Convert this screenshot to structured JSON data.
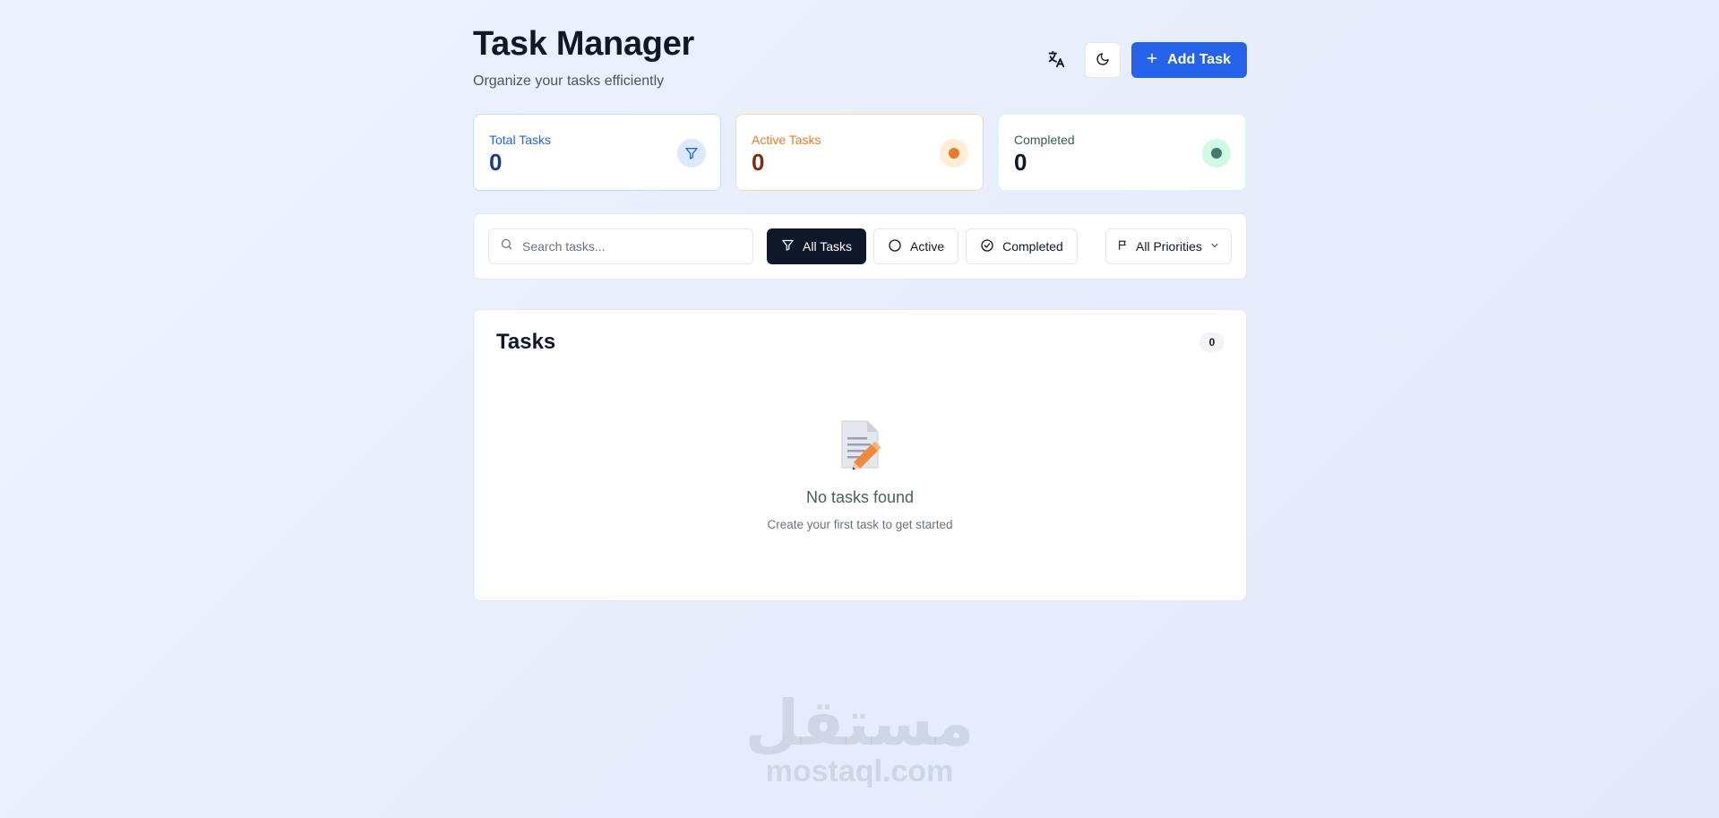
{
  "header": {
    "title": "Task Manager",
    "subtitle": "Organize your tasks efficiently",
    "add_task_label": "Add Task",
    "translate_icon": "translate-icon",
    "theme_icon": "moon-icon"
  },
  "stats": {
    "total": {
      "label": "Total Tasks",
      "value": "0",
      "color": "#2563eb",
      "icon": "filter-icon"
    },
    "active": {
      "label": "Active Tasks",
      "value": "0",
      "color": "#ea7a2b",
      "icon": "dot-icon"
    },
    "completed": {
      "label": "Completed",
      "value": "0",
      "color": "#2f6b5f",
      "icon": "dot-icon"
    }
  },
  "filters": {
    "search_placeholder": "Search tasks...",
    "all_label": "All Tasks",
    "active_label": "Active",
    "completed_label": "Completed",
    "priority_label": "All Priorities",
    "selected": "All Tasks"
  },
  "tasks": {
    "title": "Tasks",
    "count": "0",
    "empty_title": "No tasks found",
    "empty_subtitle": "Create your first task to get started"
  },
  "watermark": {
    "arabic": "مستقل",
    "latin": "mostaql.com"
  },
  "colors": {
    "accent": "#2563eb",
    "dark": "#0f172a"
  }
}
